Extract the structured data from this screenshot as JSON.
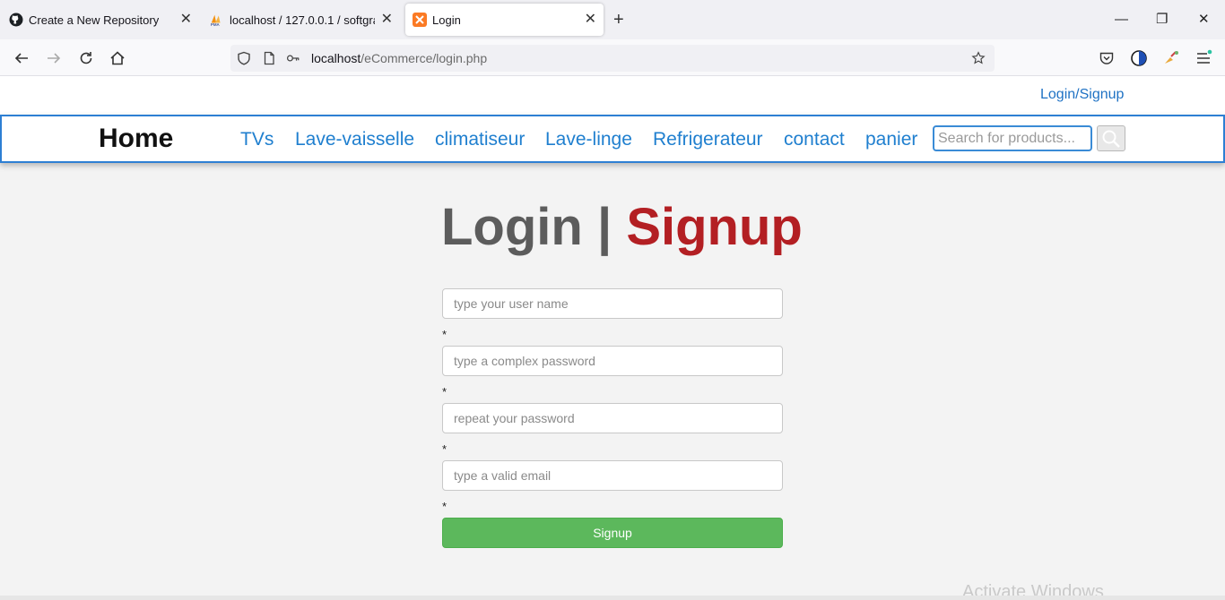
{
  "browser": {
    "tabs": [
      {
        "label": "Create a New Repository",
        "icon": "github-icon"
      },
      {
        "label": "localhost / 127.0.0.1 / softgram",
        "icon": "phpmyadmin-icon"
      },
      {
        "label": "Login",
        "icon": "xampp-icon",
        "active": true
      }
    ],
    "new_tab": "+",
    "window_controls": {
      "minimize": "—",
      "restore": "❐",
      "close": "✕"
    },
    "url": {
      "host": "localhost",
      "path": "/eCommerce/login.php"
    }
  },
  "header": {
    "login_link": "Login/Signup"
  },
  "nav": {
    "brand": "Home",
    "links": [
      "TVs",
      "Lave-vaisselle",
      "climatiseur",
      "Lave-linge",
      "Refrigerateur",
      "contact",
      "panier"
    ],
    "search_placeholder": "Search for products..."
  },
  "form": {
    "heading": {
      "login": "Login",
      "separator": "|",
      "signup": "Signup"
    },
    "fields": [
      {
        "placeholder": "type your user name"
      },
      {
        "placeholder": "type a complex password"
      },
      {
        "placeholder": "repeat your password"
      },
      {
        "placeholder": "type a valid email"
      }
    ],
    "required_mark": "*",
    "submit_label": "Signup"
  },
  "watermark": "Activate Windows",
  "colors": {
    "accent": "#1f7fcf",
    "signup_red": "#b31f23",
    "button_green": "#5cb85c"
  }
}
